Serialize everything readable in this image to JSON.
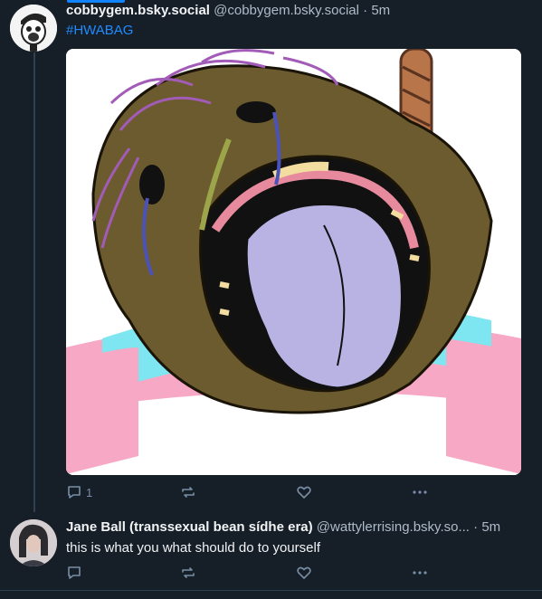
{
  "post1": {
    "display_name": "cobbygem.bsky.social",
    "handle": "@cobbygem.bsky.social",
    "separator": "·",
    "time": "5m",
    "hashtag": "#HWABAG",
    "reply_count": "1",
    "repost_count": "",
    "like_count": ""
  },
  "post2": {
    "display_name": "Jane Ball (transsexual bean sídhe era)",
    "handle": "@wattylerrising.bsky.so...",
    "separator": "·",
    "time": "5m",
    "text": "this is what you what should do to yourself",
    "reply_count": "",
    "repost_count": "",
    "like_count": ""
  },
  "colors": {
    "background": "#161e27",
    "accent": "#208bfe",
    "muted": "#788ea5",
    "divider": "#2e4052"
  },
  "icons": [
    "reply-icon",
    "repost-icon",
    "like-icon",
    "more-icon"
  ]
}
